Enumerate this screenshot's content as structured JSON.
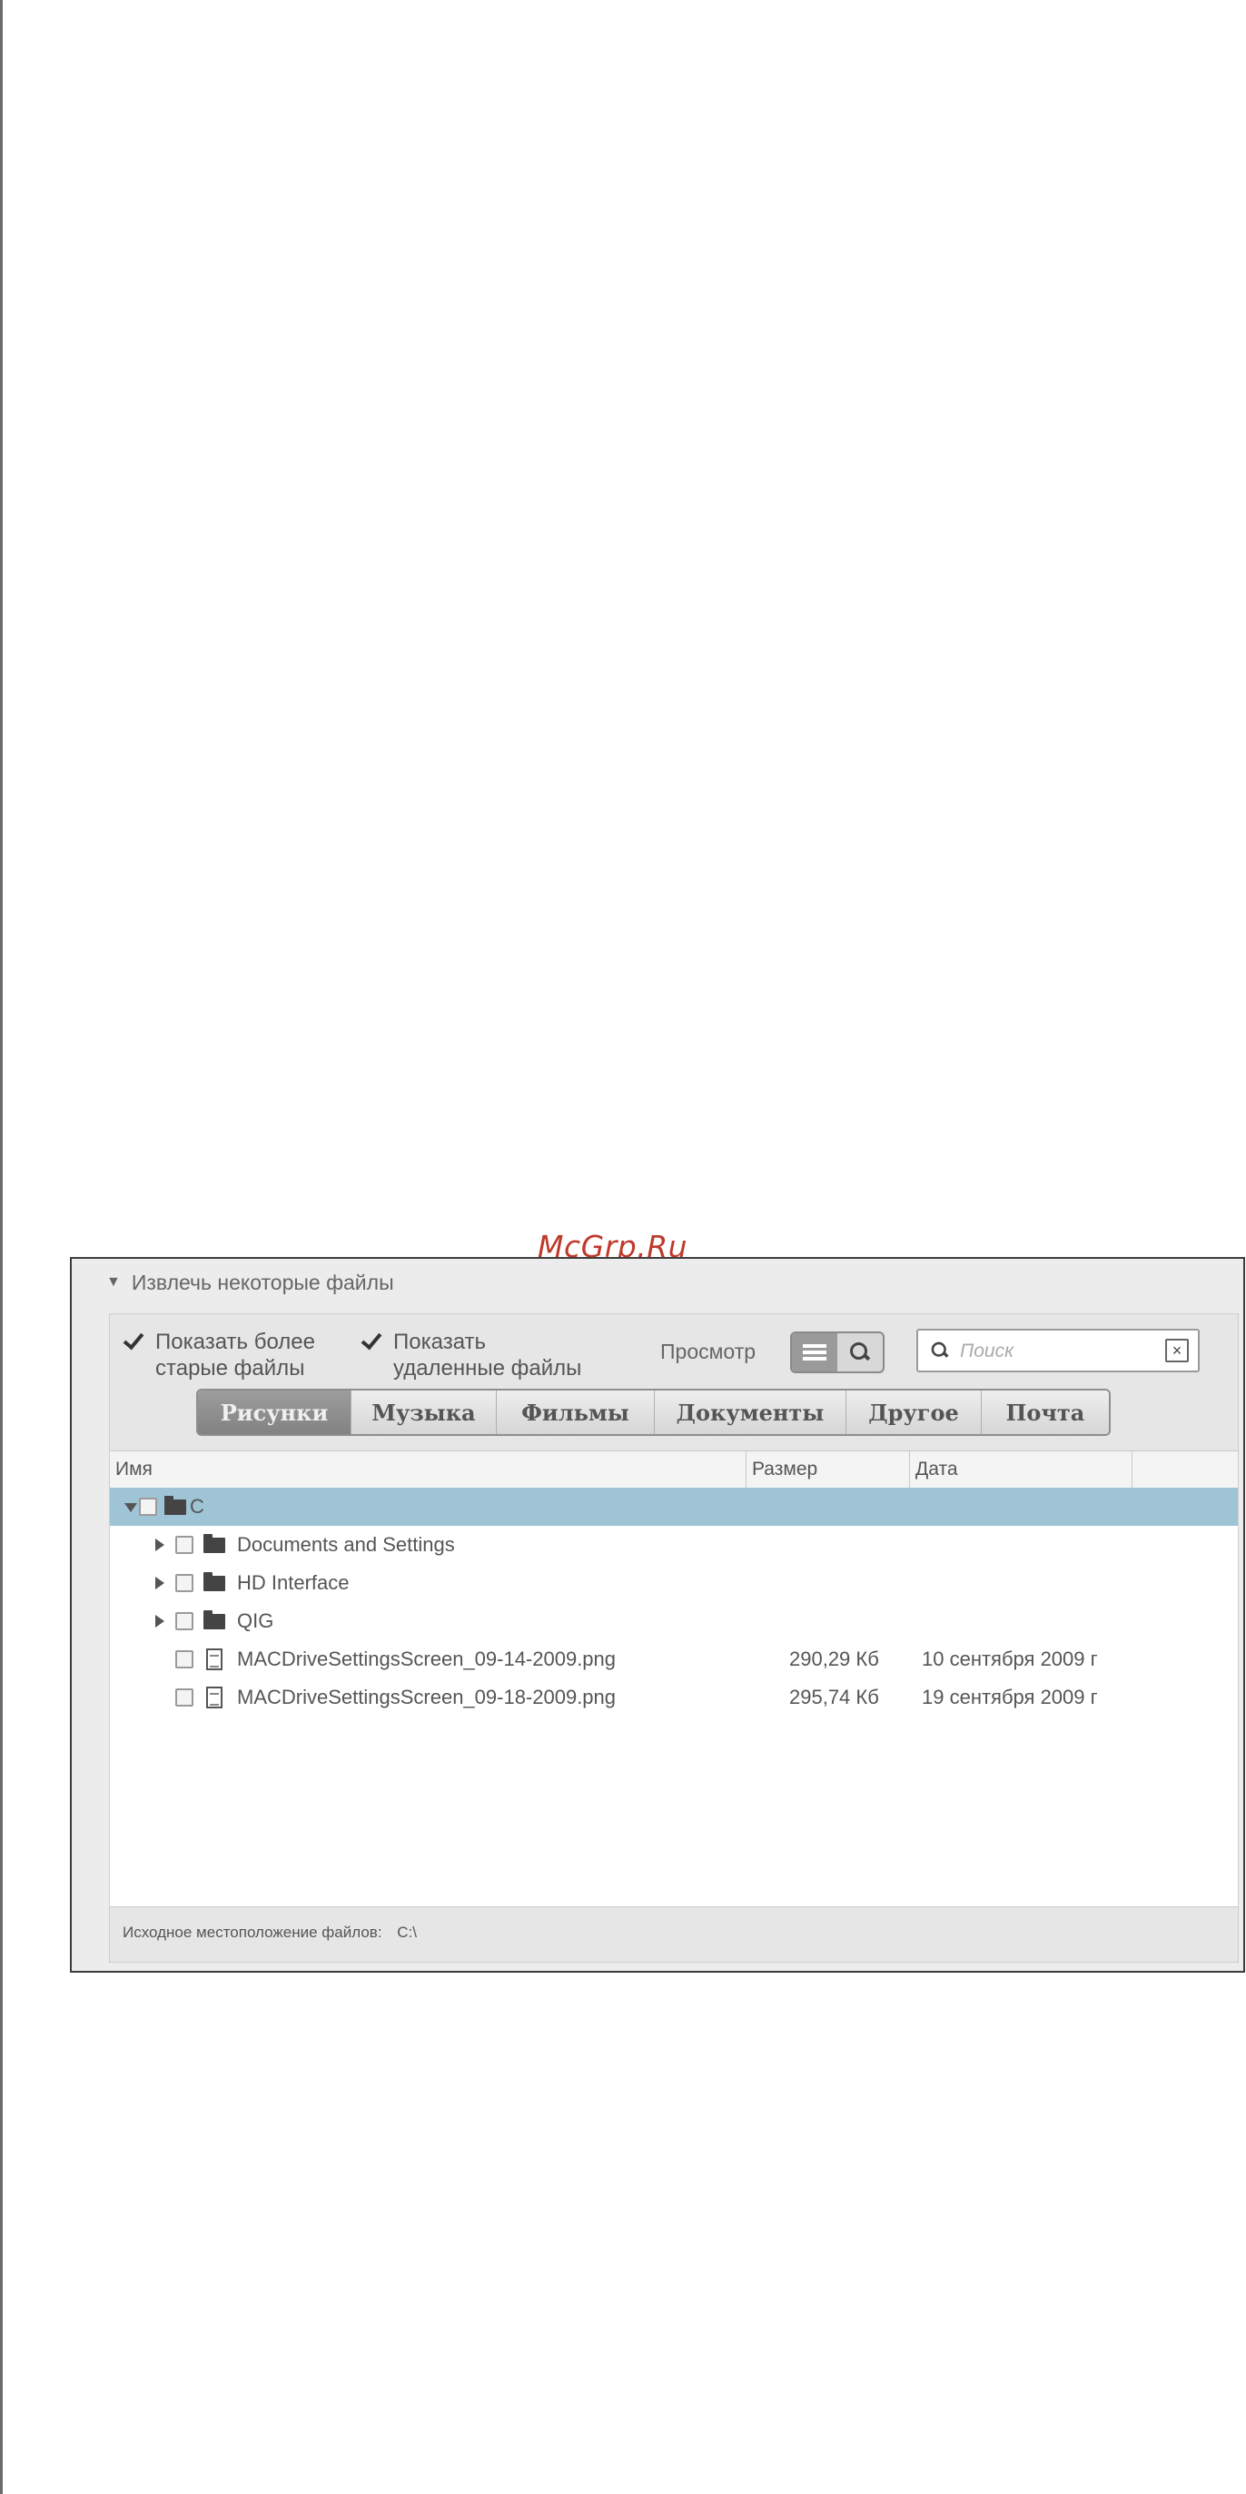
{
  "watermark": "McGrp.Ru",
  "section": {
    "title": "Извлечь некоторые файлы"
  },
  "options": {
    "show_older": {
      "line1": "Показать более",
      "line2": "старые файлы",
      "checked": true
    },
    "show_deleted": {
      "line1": "Показать",
      "line2": "удаленные файлы",
      "checked": true
    }
  },
  "view": {
    "label": "Просмотр",
    "modes": [
      "list-icon",
      "search-icon"
    ],
    "active": "list"
  },
  "search": {
    "placeholder": "Поиск",
    "clear_icon": "close-icon"
  },
  "tabs": [
    {
      "label": "Рисунки",
      "active": true
    },
    {
      "label": "Музыка",
      "active": false
    },
    {
      "label": "Фильмы",
      "active": false
    },
    {
      "label": "Документы",
      "active": false
    },
    {
      "label": "Другое",
      "active": false
    },
    {
      "label": "Почта",
      "active": false
    }
  ],
  "table": {
    "columns": {
      "name": "Имя",
      "size": "Размер",
      "date": "Дата"
    },
    "rows": [
      {
        "name": "C",
        "type": "folder",
        "expanded": true,
        "selected": true,
        "size": "",
        "date": ""
      },
      {
        "name": "Documents and Settings",
        "type": "folder",
        "expanded": false,
        "selected": false,
        "size": "",
        "date": ""
      },
      {
        "name": "HD Interface",
        "type": "folder",
        "expanded": false,
        "selected": false,
        "size": "",
        "date": ""
      },
      {
        "name": "QIG",
        "type": "folder",
        "expanded": false,
        "selected": false,
        "size": "",
        "date": ""
      },
      {
        "name": "MACDriveSettingsScreen_09-14-2009.png",
        "type": "file",
        "selected": false,
        "size": "290,29 Кб",
        "date": "10 сентября 2009 г"
      },
      {
        "name": "MACDriveSettingsScreen_09-18-2009.png",
        "type": "file",
        "selected": false,
        "size": "295,74 Кб",
        "date": "19 сентября 2009 г"
      }
    ]
  },
  "status": {
    "label": "Исходное местоположение файлов:",
    "value": "C:\\"
  },
  "colors": {
    "selected_row": "#9ec4d6",
    "active_tab": "#8f8f8f",
    "watermark": "#c0392b"
  }
}
